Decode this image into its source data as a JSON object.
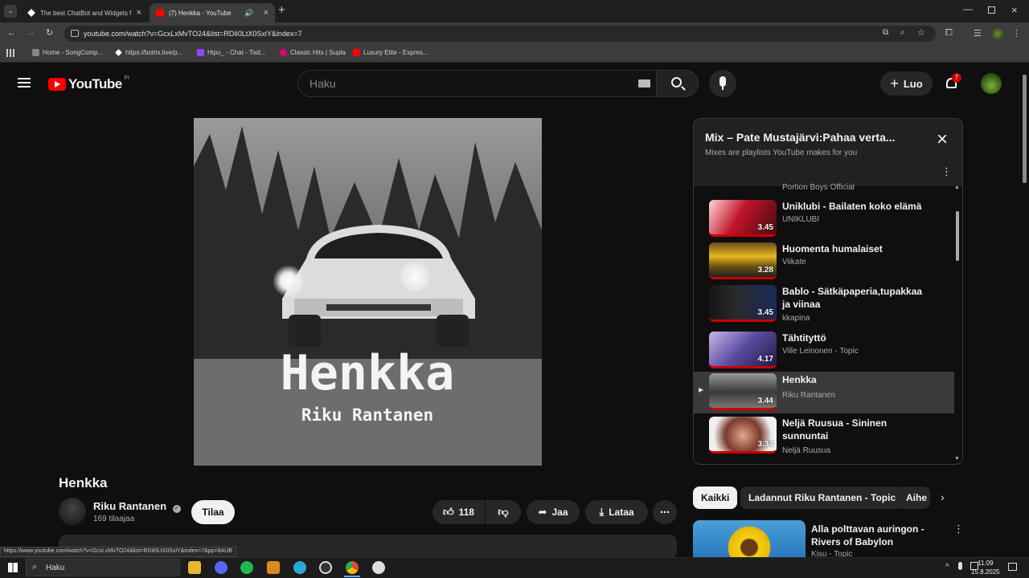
{
  "browser": {
    "tabs": [
      {
        "title": "The best ChatBot and Widgets f",
        "active": false
      },
      {
        "title": "(7) Henkka - YouTube",
        "active": true
      }
    ],
    "url": "youtube.com/watch?v=GcxLxMvTO24&list=RDiI0LtX0SxiY&index=7",
    "bookmarks": [
      "Home - SongComp...",
      "https://botrix.live/p...",
      "Hipu_ - Chat - Twit...",
      "Classic Hits | Supla",
      "Luxury Elite - Expres..."
    ],
    "status_url": "https://www.youtube.com/watch?v=GcxLxMvTO24&list=RDiI0LtX0SxiY&index=7&pp=8AUB"
  },
  "masthead": {
    "logo_text": "YouTube",
    "region": "FI",
    "search_placeholder": "Haku",
    "create_label": "Luo",
    "notifications_count": "7"
  },
  "video": {
    "art_title": "Henkka",
    "art_artist": "Riku Rantanen",
    "title": "Henkka",
    "channel": "Riku Rantanen",
    "subscribers": "169 tilaajaa",
    "subscribe_label": "Tilaa",
    "likes": "118",
    "share_label": "Jaa",
    "download_label": "Lataa"
  },
  "playlist": {
    "title": "Mix – Pate Mustajärvi:Pahaa verta...",
    "subtitle": "Mixes are playlists YouTube makes for you",
    "partial_channel": "Portion Boys Official",
    "items": [
      {
        "title": "Uniklubi - Bailaten koko elämä",
        "channel": "UNIKLUBI",
        "duration": "3.45"
      },
      {
        "title": "Huomenta humalaiset",
        "channel": "Viikate",
        "duration": "3.28"
      },
      {
        "title": "Bablo - Sätkäpaperia,tupakkaa ja viinaa",
        "channel": "kkapina",
        "duration": "3.45"
      },
      {
        "title": "Tähtityttö",
        "channel": "Ville Leinonen - Topic",
        "duration": "4.17"
      },
      {
        "title": "Henkka",
        "channel": "Riku Rantanen",
        "duration": "3.44",
        "current": true
      },
      {
        "title": "Neljä Ruusua - Sininen sunnuntai",
        "channel": "Neljä Ruusua",
        "duration": "3.34"
      }
    ]
  },
  "chips": [
    "Kaikki",
    "Ladannut Riku Rantanen - Topic",
    "Aihe"
  ],
  "recommended": {
    "title": "Alla polttavan auringon - Rivers of Babylon",
    "channel": "Kisu - Topic"
  },
  "taskbar": {
    "search_placeholder": "Haku",
    "time": "11.09",
    "date": "15.8.2025"
  },
  "colors": {
    "accent": "#ff0000",
    "background": "#0f0f0f",
    "progress": "#cc0000"
  }
}
